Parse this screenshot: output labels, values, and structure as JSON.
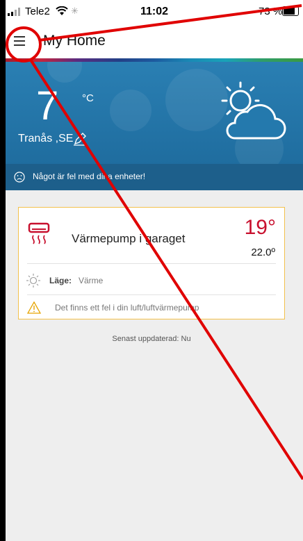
{
  "status_bar": {
    "carrier": "Tele2",
    "time": "11:02",
    "battery": "73 %"
  },
  "navbar": {
    "title": "My Home",
    "menu_icon": "hamburger-menu-icon"
  },
  "weather": {
    "temperature": "7",
    "unit": "°C",
    "location": "Tranås ,SE",
    "icon": "sun-behind-cloud-icon"
  },
  "alert": {
    "text": "Något är fel med dina enheter!",
    "icon": "sad-face-icon"
  },
  "device": {
    "name": "Värmepump i garaget",
    "current_temp": "19°",
    "set_temp": "22.0º",
    "mode_label": "Läge:",
    "mode_value": "Värme",
    "warning": "Det finns ett fel i din luft/luftvärmepump",
    "icon": "heat-pump-icon"
  },
  "last_updated": "Senast uppdaterad: Nu",
  "colors": {
    "accent_red": "#c8102e",
    "card_border": "#f3c14b",
    "weather_bg": "#2a7fb3",
    "annotation_red": "#e00000"
  }
}
